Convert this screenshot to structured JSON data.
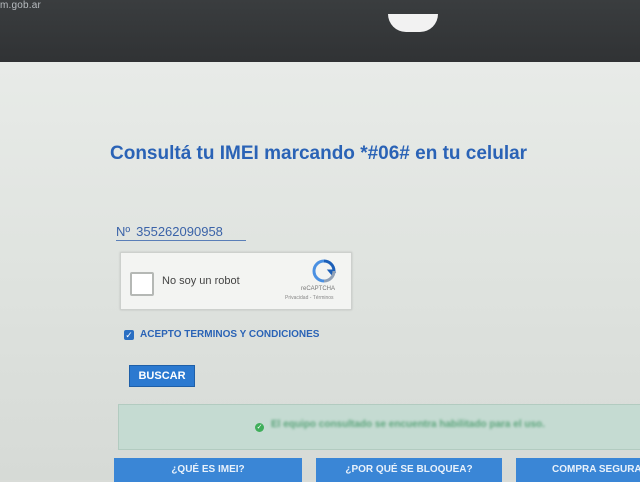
{
  "browser": {
    "url_fragment": "m.gob.ar"
  },
  "main": {
    "title": "Consultá tu IMEI marcando *#06# en tu celular",
    "imei": {
      "prefix": "Nº",
      "value": "355262090958"
    },
    "captcha": {
      "label": "No soy un robot",
      "brand": "reCAPTCHA",
      "links": "Privacidad - Términos"
    },
    "terms": {
      "checked": true,
      "label": "ACEPTO TERMINOS Y CONDICIONES"
    },
    "search_button": "BUSCAR",
    "status_message": "El equipo consultado se encuentra habilitado para el uso.",
    "status_color": "#5aa47a"
  },
  "bottom_tabs": [
    {
      "label": "¿QUÉ ES IMEI?"
    },
    {
      "label": "¿POR QUÉ SE BLOQUEA?"
    },
    {
      "label": "COMPRA SEGURA"
    }
  ],
  "colors": {
    "accent": "#2a63b6",
    "button": "#2b79d0",
    "success": "#3fae5a"
  }
}
